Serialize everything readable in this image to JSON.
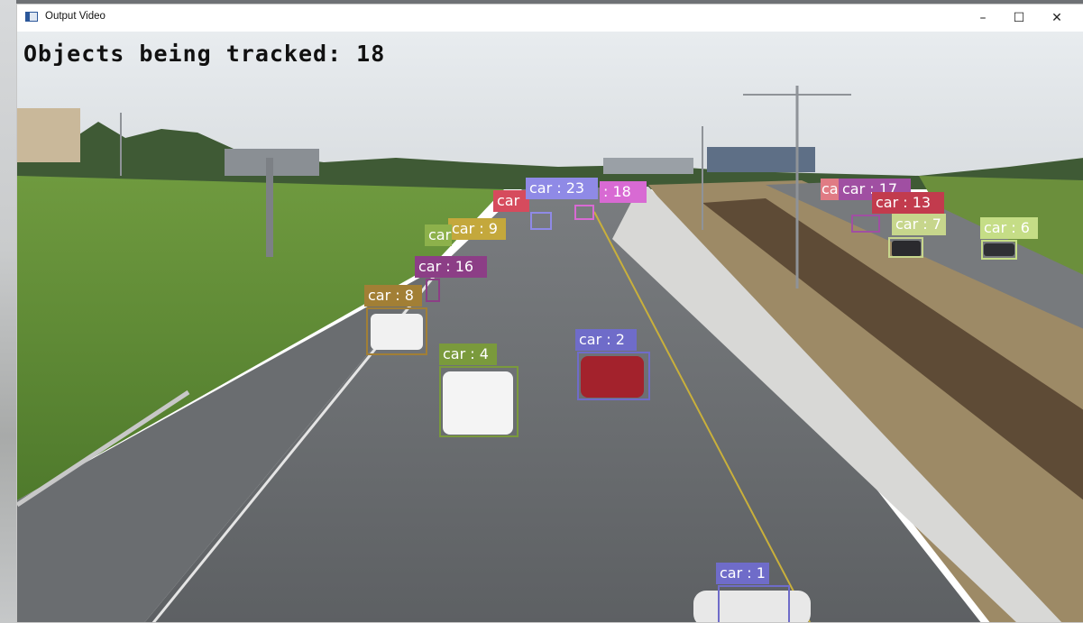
{
  "window": {
    "title": "Output Video",
    "controls": {
      "minimize": "–",
      "maximize": "☐",
      "close": "✕"
    }
  },
  "overlay": {
    "tracked_text": "Objects being tracked: 18"
  },
  "detections": [
    {
      "label": "car : 1",
      "color": "#6f6cc9"
    },
    {
      "label": "car : 2",
      "color": "#6f6cc9"
    },
    {
      "label": "car : 4",
      "color": "#7a9a3c"
    },
    {
      "label": "car : 8",
      "color": "#a27f35"
    },
    {
      "label": "car : 16",
      "color": "#8c3e86"
    },
    {
      "label": "car : 9",
      "color": "#c4a83c"
    },
    {
      "label": "car",
      "color": "#8db14b"
    },
    {
      "label": "car",
      "color": "#d64b5d"
    },
    {
      "label": "car : 23",
      "color": "#8f8ae6"
    },
    {
      "label": ": 18",
      "color": "#d86ad3"
    },
    {
      "label": "ca",
      "color": "#e07b84"
    },
    {
      "label": "car : 17",
      "color": "#a04fa2"
    },
    {
      "label": "car : 13",
      "color": "#c23b4d"
    },
    {
      "label": "car : 7",
      "color": "#c7d68c"
    },
    {
      "label": "car : 6",
      "color": "#c5dd86"
    }
  ]
}
